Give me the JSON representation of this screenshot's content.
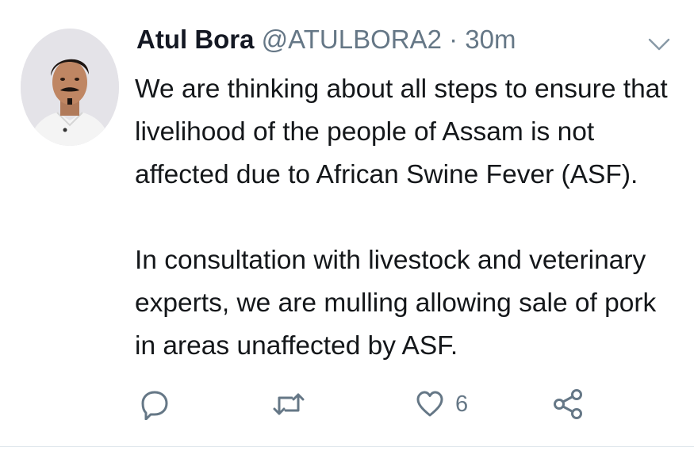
{
  "tweet": {
    "author": {
      "name": "Atul Bora",
      "handle": "@ATULBORA2",
      "separator": "·",
      "time": "30m"
    },
    "text": {
      "paragraph1": [
        "We are thinking about all steps to ensure that",
        "livelihood of the people of Assam is not",
        "affected due to African Swine Fever (ASF)."
      ],
      "paragraph2": [
        "In consultation with livestock and veterinary",
        "experts, we are mulling allowing sale of pork",
        "in areas unaffected by ASF."
      ]
    },
    "actions": {
      "reply": {
        "icon": "reply-icon"
      },
      "retweet": {
        "icon": "retweet-icon"
      },
      "like": {
        "icon": "heart-icon",
        "count": "6"
      },
      "share": {
        "icon": "share-icon"
      }
    },
    "menu": {
      "icon": "chevron-down-icon"
    }
  },
  "colors": {
    "text": "#14171a",
    "secondary": "#657786",
    "icon": "#657786",
    "border": "#e1e8ed"
  }
}
